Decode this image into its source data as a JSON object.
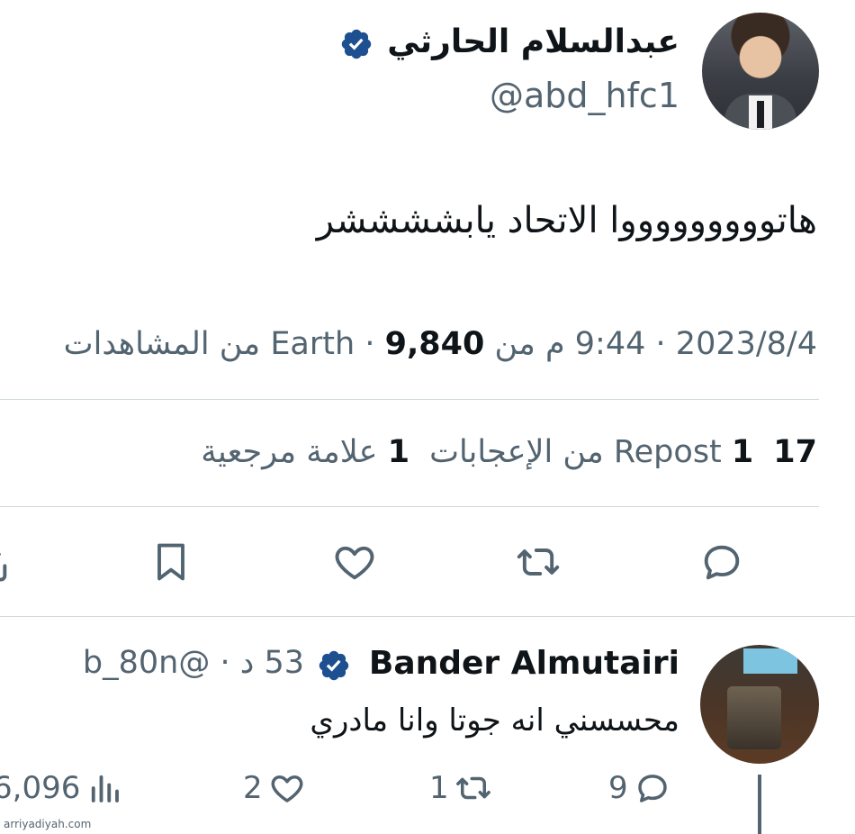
{
  "tweet": {
    "display_name": "عبدالسلام الحارثي",
    "handle": "@abd_hfc1",
    "text": "هاتوووووووووا الاتحاد يابششششر",
    "date": "2023/8/4",
    "time": "9:44 م من",
    "location": "Earth",
    "views_count": "9,840",
    "views_label": "من المشاهدات",
    "reposts_count": "1",
    "reposts_label": "Repost",
    "likes_count": "17",
    "likes_label": "من الإعجابات",
    "bookmarks_count": "1",
    "bookmarks_label": "علامة مرجعية",
    "separator": "·"
  },
  "reply": {
    "display_name": "Bander Almutairi",
    "handle": "@b_80n",
    "age": "53 د",
    "text": "محسسني انه جوتا وانا مادري",
    "replies": "9",
    "reposts": "1",
    "likes": "2",
    "views": "6,096"
  },
  "watermark": "arriyadiyah.com",
  "colors": {
    "text_primary": "#0f1419",
    "text_secondary": "#536471",
    "verified": "#1d4f91",
    "divider": "#cfd9de"
  },
  "icons": {
    "verified": "verified-badge-icon",
    "reply": "speech-bubble-icon",
    "repost": "repost-arrows-icon",
    "like": "heart-icon",
    "bookmark": "bookmark-icon",
    "views": "bar-chart-icon"
  }
}
